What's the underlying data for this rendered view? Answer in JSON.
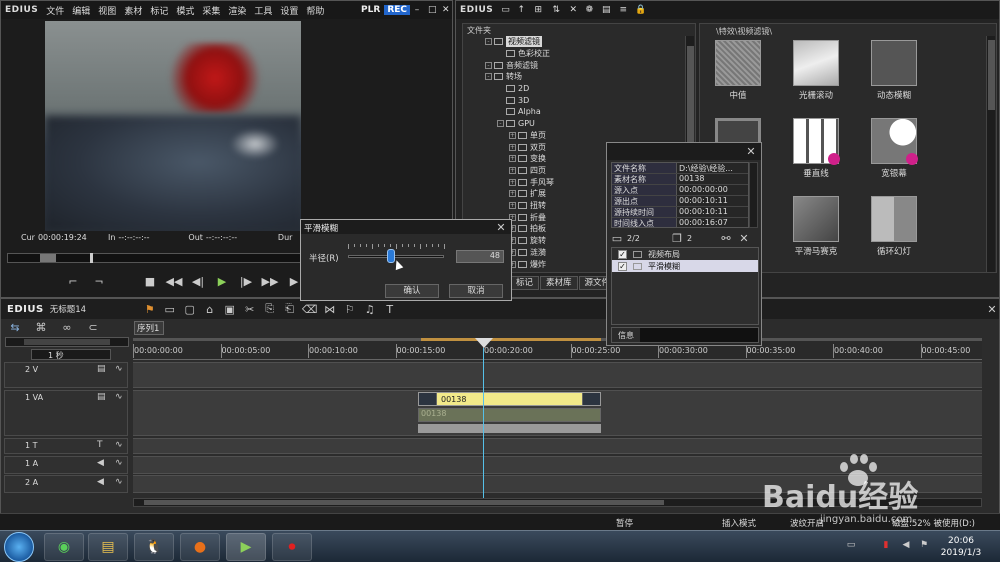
{
  "app": {
    "brand": "EDIUS"
  },
  "player_menu": [
    "文件",
    "编辑",
    "视图",
    "素材",
    "标记",
    "模式",
    "采集",
    "渲染",
    "工具",
    "设置",
    "帮助"
  ],
  "player": {
    "plr_label": "PLR",
    "rec_label": "REC",
    "cur_label": "Cur",
    "cur_value": "00:00:19:24",
    "in_label": "In",
    "in_value": "--:--:--:--",
    "out_label": "Out",
    "out_value": "--:--:--:--",
    "dur_label": "Dur"
  },
  "effects_panel": {
    "brand": "EDIUS",
    "tree_header": "文件夹",
    "tree_items": [
      {
        "label": "视频滤镜",
        "indent": 1,
        "selected": true
      },
      {
        "label": "色彩校正",
        "indent": 2,
        "selected": false
      },
      {
        "label": "音频滤镜",
        "indent": 1,
        "selected": false
      },
      {
        "label": "转场",
        "indent": 1,
        "selected": false
      },
      {
        "label": "2D",
        "indent": 2,
        "selected": false
      },
      {
        "label": "3D",
        "indent": 2,
        "selected": false
      },
      {
        "label": "Alpha",
        "indent": 2,
        "selected": false
      },
      {
        "label": "GPU",
        "indent": 2,
        "selected": false
      },
      {
        "label": "单页",
        "indent": 3,
        "selected": false
      },
      {
        "label": "双页",
        "indent": 3,
        "selected": false
      },
      {
        "label": "变换",
        "indent": 3,
        "selected": false
      },
      {
        "label": "四页",
        "indent": 3,
        "selected": false
      },
      {
        "label": "手风琴",
        "indent": 3,
        "selected": false
      },
      {
        "label": "扩展",
        "indent": 3,
        "selected": false
      },
      {
        "label": "扭转",
        "indent": 3,
        "selected": false
      },
      {
        "label": "折叠",
        "indent": 3,
        "selected": false
      },
      {
        "label": "拍板",
        "indent": 3,
        "selected": false
      },
      {
        "label": "旋转",
        "indent": 3,
        "selected": false
      },
      {
        "label": "涟漪",
        "indent": 3,
        "selected": false
      },
      {
        "label": "爆炸",
        "indent": 3,
        "selected": false
      }
    ],
    "path_label": "\\特效\\视频滤镜\\",
    "thumbnails": [
      {
        "label": "中值"
      },
      {
        "label": "光栅滚动"
      },
      {
        "label": "动态模糊"
      },
      {
        "label": ""
      },
      {
        "label": "垂直线"
      },
      {
        "label": "宽银幕"
      },
      {
        "label": ""
      },
      {
        "label": "平滑马赛克"
      },
      {
        "label": "循环幻灯"
      }
    ],
    "tabs": [
      "标记",
      "素材库",
      "源文件浏"
    ]
  },
  "info_panel": {
    "rows": [
      {
        "key": "文件名称",
        "value": "D:\\经验\\经验..."
      },
      {
        "key": "素材名称",
        "value": "00138"
      },
      {
        "key": "源入点",
        "value": "00:00:00:00"
      },
      {
        "key": "源出点",
        "value": "00:00:10:11"
      },
      {
        "key": "源持续时间",
        "value": "00:00:10:11"
      },
      {
        "key": "时间线入点",
        "value": "00:00:16:07"
      }
    ],
    "page_count": "2/2",
    "layer_count": "2",
    "effects": [
      {
        "label": "视频布局",
        "checked": true,
        "selected": false
      },
      {
        "label": "平滑模糊",
        "checked": true,
        "selected": true
      }
    ],
    "footer_label": "信息"
  },
  "dialog": {
    "title": "平滑模糊",
    "radius_label": "半径(R)",
    "radius_value": "48",
    "radius_fraction": 0.45,
    "ok_label": "确认",
    "cancel_label": "取消"
  },
  "timeline": {
    "brand": "EDIUS",
    "project_name": "无标题14",
    "sequence_tab": "序列1",
    "scale_label": "1 秒",
    "ruler_ticks": [
      "00:00:00:00",
      "00:00:05:00",
      "00:00:10:00",
      "00:00:15:00",
      "00:00:20:00",
      "00:00:25:00",
      "00:00:30:00",
      "00:00:35:00",
      "00:00:40:00",
      "00:00:45:00"
    ],
    "tracks": [
      {
        "label": "2 V"
      },
      {
        "label": "1 VA"
      },
      {
        "label": "1 T"
      },
      {
        "label": "1 A"
      },
      {
        "label": "2 A"
      }
    ],
    "clip_name": "00138",
    "clip_audio_name": "00138"
  },
  "statusbar": {
    "pause": "暂停",
    "insert_mode": "插入模式",
    "ripple": "波纹开启",
    "disk": "磁盘:52% 被使用(D:)"
  },
  "taskbar": {
    "time": "20:06",
    "date": "2019/1/3"
  },
  "watermark": {
    "brand": "Baidu经验",
    "url": "jingyan.baidu.com"
  },
  "colors": {
    "clip_yellow": "#f2e98a",
    "accent_blue": "#2a7ad8",
    "rec_blue": "#2266cc",
    "playhead": "#55c0e8"
  }
}
